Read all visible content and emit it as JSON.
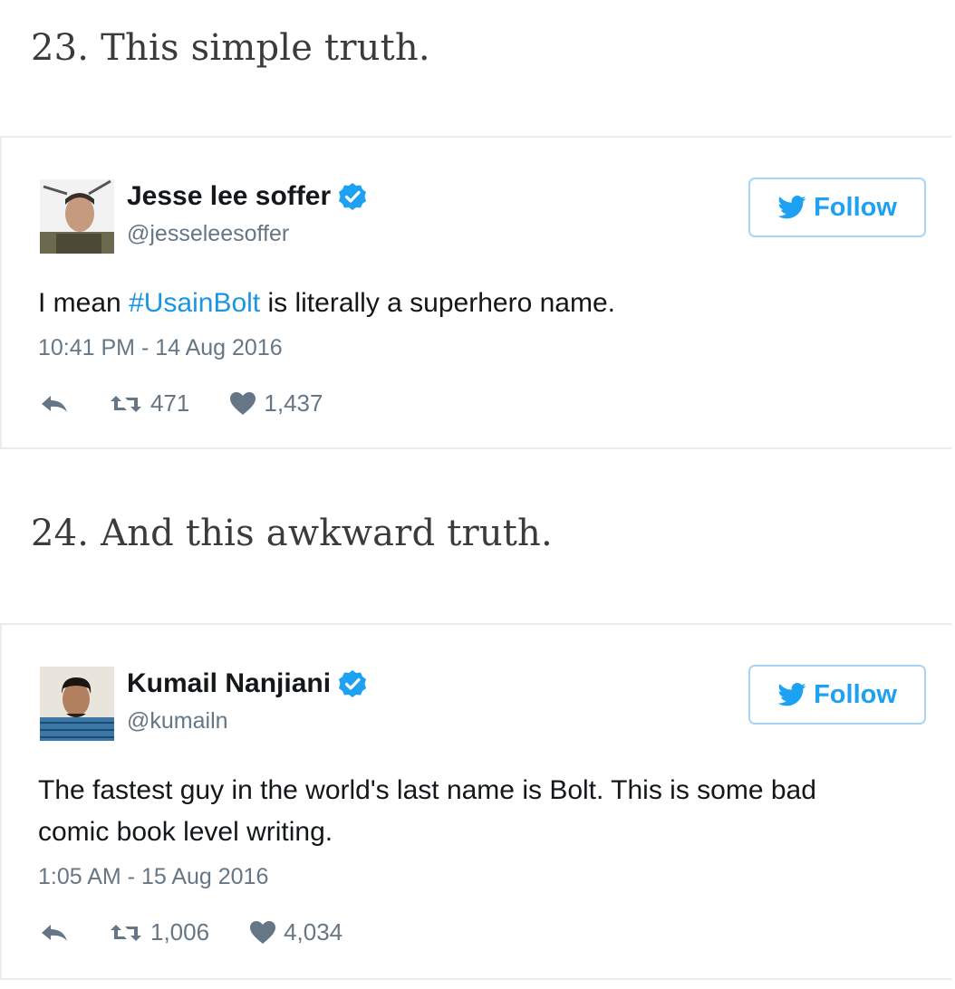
{
  "headings": [
    "23. This simple truth.",
    "24. And this awkward truth."
  ],
  "tweets": [
    {
      "name": "Jesse lee soffer",
      "handle": "@jesseleesoffer",
      "follow_label": "Follow",
      "text_before": "I mean ",
      "hashtag": "#UsainBolt",
      "text_after": " is literally a superhero name.",
      "timestamp": "10:41 PM - 14 Aug 2016",
      "retweets": "471",
      "likes": "1,437"
    },
    {
      "name": "Kumail Nanjiani",
      "handle": "@kumailn",
      "follow_label": "Follow",
      "text": "The fastest guy in the world's last name is Bolt. This is some bad comic book level writing.",
      "timestamp": "1:05 AM - 15 Aug 2016",
      "retweets": "1,006",
      "likes": "4,034"
    }
  ],
  "colors": {
    "link": "#1b95e0",
    "verified": "#1da1f2",
    "muted": "#657786",
    "follow_border": "#a8d4f5"
  },
  "icons": {
    "reply": "reply-icon",
    "retweet": "retweet-icon",
    "like": "heart-icon",
    "verified": "verified-badge-icon",
    "twitter": "twitter-bird-icon"
  }
}
